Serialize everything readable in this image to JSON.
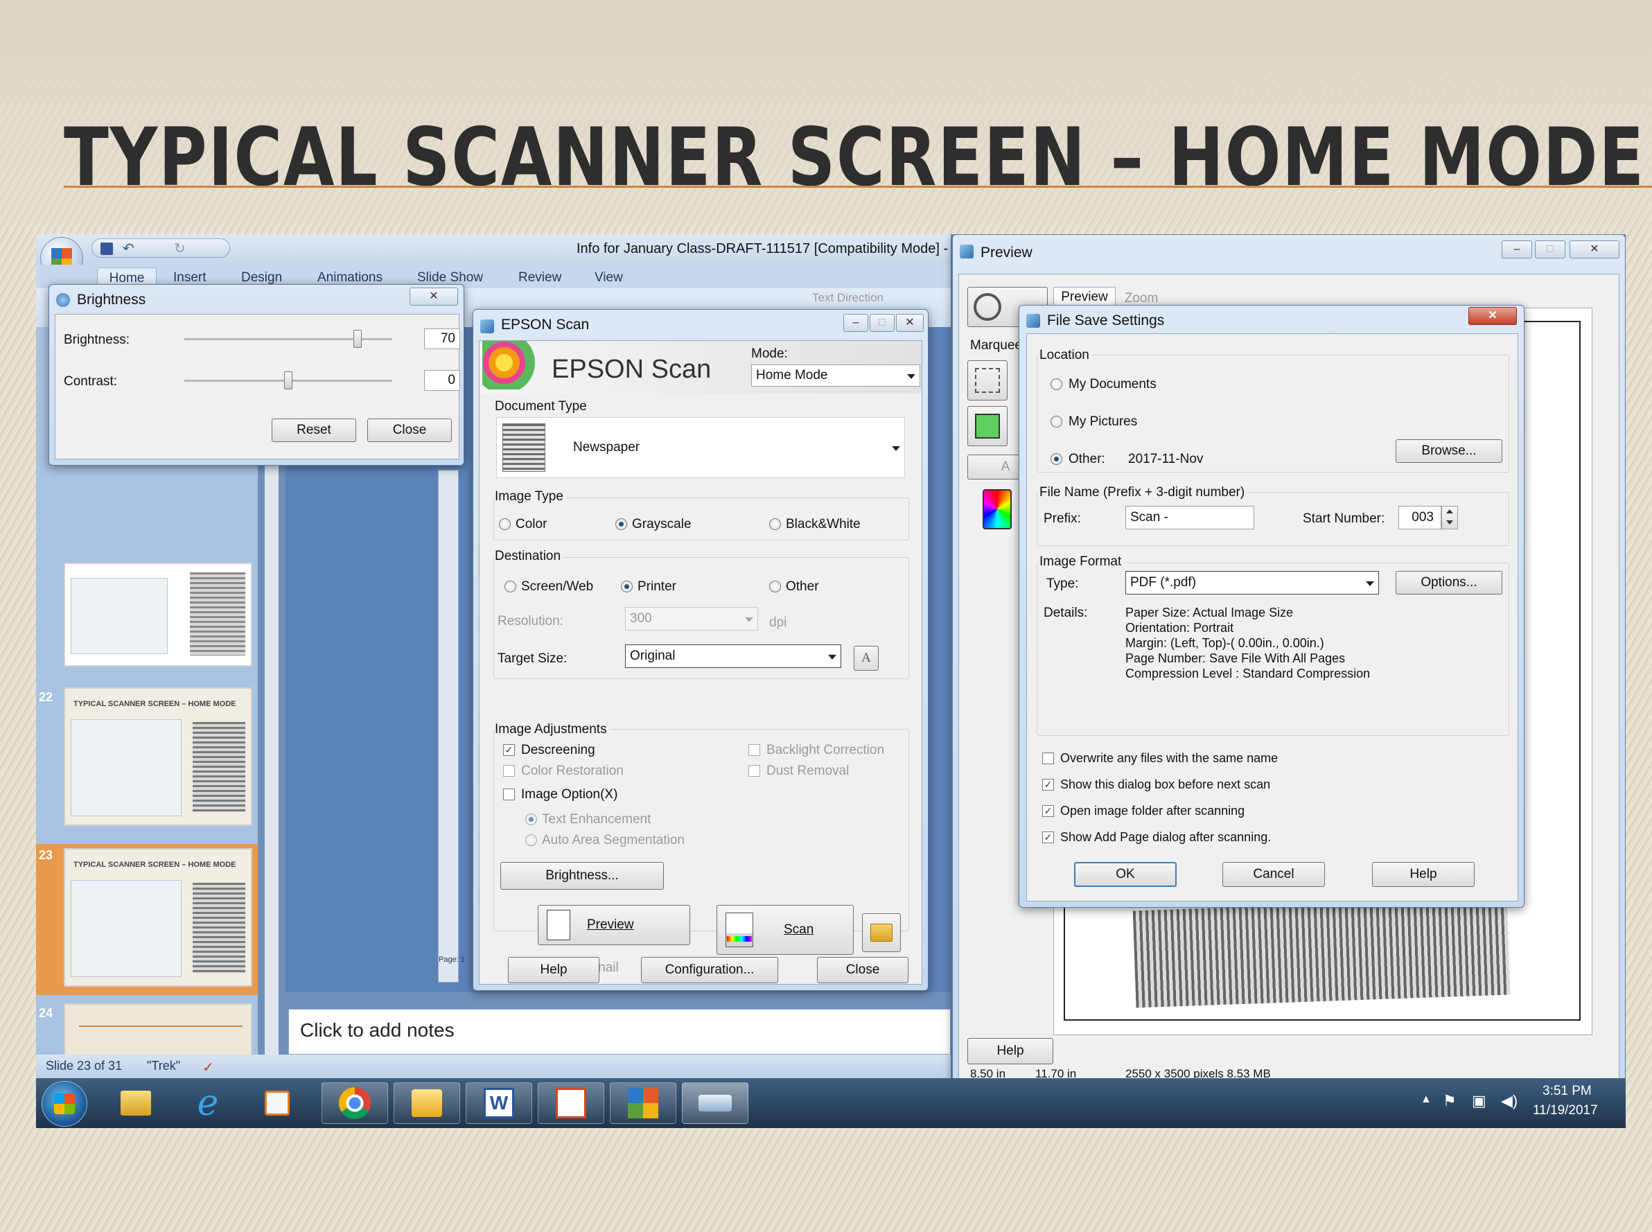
{
  "slide_title": "TYPICAL SCANNER SCREEN – HOME MODE",
  "ppt": {
    "title": "Info for January Class-DRAFT-111517 [Compatibility Mode] -",
    "tabs": [
      "Home",
      "Insert",
      "Design",
      "Animations",
      "Slide Show",
      "Review",
      "View"
    ],
    "text_direction": "Text Direction",
    "thumbs": [
      {
        "num": "22",
        "caption": "TYPICAL SCANNER SCREEN – HOME MODE"
      },
      {
        "num": "23",
        "caption": "TYPICAL SCANNER SCREEN – HOME MODE"
      },
      {
        "num": "24",
        "caption": ""
      }
    ],
    "notes_placeholder": "Click to add notes",
    "status_slide": "Slide 23 of 31",
    "status_theme": "\"Trek\"",
    "page_label": "Page: 1"
  },
  "brightness": {
    "title": "Brightness",
    "brightness_label": "Brightness:",
    "brightness_value": "70",
    "contrast_label": "Contrast:",
    "contrast_value": "0",
    "reset": "Reset",
    "close": "Close"
  },
  "epson": {
    "title": "EPSON Scan",
    "logo": "EPSON Scan",
    "mode_label": "Mode:",
    "mode_value": "Home Mode",
    "doc_type_label": "Document Type",
    "doc_type_value": "Newspaper",
    "image_type_label": "Image Type",
    "image_types": [
      "Color",
      "Grayscale",
      "Black&White"
    ],
    "destination_label": "Destination",
    "destinations": [
      "Screen/Web",
      "Printer",
      "Other"
    ],
    "resolution_label": "Resolution:",
    "resolution_value": "300",
    "dpi": "dpi",
    "target_size_label": "Target Size:",
    "target_size_value": "Original",
    "adjust_label": "Image Adjustments",
    "descreening": "Descreening",
    "backlight": "Backlight Correction",
    "color_restoration": "Color Restoration",
    "dust_removal": "Dust Removal",
    "image_option": "Image Option(X)",
    "text_enhancement": "Text Enhancement",
    "auto_area": "Auto Area Segmentation",
    "brightness_btn": "Brightness...",
    "preview_btn": "Preview",
    "scan_btn": "Scan",
    "thumbnail": "Thumbnail",
    "help": "Help",
    "configuration": "Configuration...",
    "close": "Close"
  },
  "preview": {
    "title": "Preview",
    "tab_preview": "Preview",
    "tab_zoom": "Zoom",
    "marquee": "Marquee",
    "help": "Help",
    "status": "2550 x 3500 pixels 8.53 MB",
    "size_w": "8.50 in",
    "size_h": "11.70 in"
  },
  "file_save": {
    "title": "File Save Settings",
    "location_label": "Location",
    "my_documents": "My Documents",
    "my_pictures": "My Pictures",
    "other_label": "Other:",
    "other_value": "2017-11-Nov",
    "browse": "Browse...",
    "file_name_label": "File Name (Prefix + 3-digit number)",
    "prefix_label": "Prefix:",
    "prefix_value": "Scan -",
    "start_label": "Start Number:",
    "start_value": "003",
    "image_format_label": "Image Format",
    "type_label": "Type:",
    "type_value": "PDF (*.pdf)",
    "options": "Options...",
    "details_label": "Details:",
    "details": [
      "Paper Size: Actual Image Size",
      "Orientation: Portrait",
      "Margin: (Left, Top)-( 0.00in., 0.00in.)",
      "Page Number: Save File With All Pages",
      "Compression Level : Standard Compression"
    ],
    "overwrite": "Overwrite any files with the same name",
    "show_dialog": "Show this dialog box before next scan",
    "open_folder": "Open image folder after scanning",
    "show_add_page": "Show Add Page dialog after scanning.",
    "ok": "OK",
    "cancel": "Cancel",
    "help": "Help"
  },
  "taskbar": {
    "time": "3:51 PM",
    "date": "11/19/2017"
  }
}
